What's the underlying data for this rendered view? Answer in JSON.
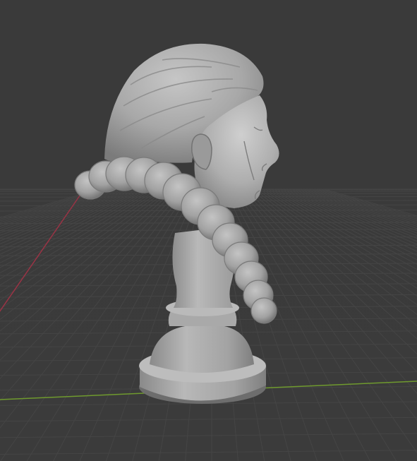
{
  "viewport": {
    "mode": "3d-viewport-solid-shading",
    "object": "marble-bust-sculpt",
    "colors": {
      "background_top": "#3a3a3a",
      "background_bottom": "#3b3b3b",
      "grid_line": "#444444",
      "x_axis": "#9a3345",
      "y_axis": "#6f9a2e",
      "mesh_light": "#c9c9c9",
      "mesh_mid": "#9f9f9f",
      "mesh_dark": "#5f5f5f"
    },
    "axes": {
      "x_axis_visible": true,
      "y_axis_visible": true
    },
    "grid": {
      "visible": true
    }
  }
}
